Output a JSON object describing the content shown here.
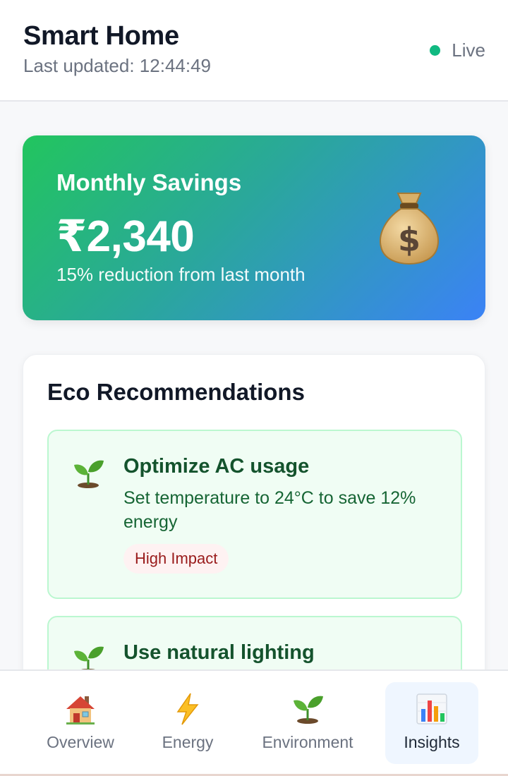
{
  "header": {
    "title": "Smart Home",
    "last_updated": "Last updated: 12:44:49",
    "status_label": "Live",
    "status_color": "#10b981"
  },
  "savings": {
    "title": "Monthly Savings",
    "amount": "₹2,340",
    "subtitle": "15% reduction from last month",
    "icon": "money-bag-icon"
  },
  "eco": {
    "title": "Eco Recommendations",
    "items": [
      {
        "icon": "seedling-icon",
        "title": "Optimize AC usage",
        "description": "Set temperature to 24°C to save 12% energy",
        "impact": "High Impact"
      },
      {
        "icon": "seedling-icon",
        "title": "Use natural lighting"
      }
    ]
  },
  "nav": {
    "items": [
      {
        "label": "Overview",
        "icon": "house-icon"
      },
      {
        "label": "Energy",
        "icon": "lightning-icon"
      },
      {
        "label": "Environment",
        "icon": "seedling-icon"
      },
      {
        "label": "Insights",
        "icon": "bar-chart-icon",
        "active": true
      }
    ]
  }
}
